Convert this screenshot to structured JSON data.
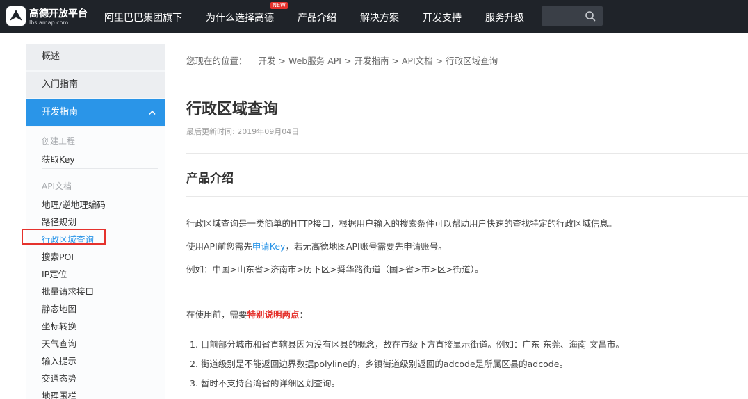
{
  "header": {
    "logo_title": "高德开放平台",
    "logo_sub": "lbs.amap.com",
    "nav": [
      {
        "label": "阿里巴巴集团旗下"
      },
      {
        "label": "为什么选择高德",
        "badge": "NEW"
      },
      {
        "label": "产品介绍"
      },
      {
        "label": "解决方案"
      },
      {
        "label": "开发支持"
      },
      {
        "label": "服务升级"
      }
    ],
    "search_placeholder": ""
  },
  "sidebar": {
    "sections": [
      "概述",
      "入门指南",
      "开发指南"
    ],
    "group1_label": "创建工程",
    "group1_links": [
      "获取Key"
    ],
    "group2_label": "API文档",
    "group2_links": [
      "地理/逆地理编码",
      "路径规划",
      "行政区域查询",
      "搜索POI",
      "IP定位",
      "批量请求接口",
      "静态地图",
      "坐标转换",
      "天气查询",
      "输入提示",
      "交通态势",
      "地理围栏"
    ],
    "current": "行政区域查询"
  },
  "breadcrumb": {
    "label": "您现在的位置：",
    "items": [
      "开发",
      "Web服务 API",
      "开发指南",
      "API文档",
      "行政区域查询"
    ],
    "sep": ">"
  },
  "page": {
    "title": "行政区域查询",
    "updated": "最后更新时间: 2019年09月04日",
    "section_title": "产品介绍",
    "p1": "行政区域查询是一类简单的HTTP接口，根据用户输入的搜索条件可以帮助用户快速的查找特定的行政区域信息。",
    "p2_before": "使用API前您需先",
    "p2_link": "申请Key",
    "p2_after": "，若无高德地图API账号需要先申请账号。",
    "p3": "例如：中国>山东省>济南市>历下区>舜华路街道（国>省>市>区>街道）。",
    "p4_before": "在使用前，需要",
    "p4_emph": "特别说明两点",
    "p4_after": "：",
    "notes": [
      "1. 目前部分城市和省直辖县因为没有区县的概念，故在市级下方直接显示街道。例如：广东-东莞、海南-文昌市。",
      "2. 街道级别是不能返回边界数据polyline的，乡镇街道级别返回的adcode是所属区县的adcode。",
      "3. 暂时不支持台湾省的详细区划查询。"
    ]
  },
  "colors": {
    "accent": "#2a95e8",
    "header_bg": "#1f2329",
    "highlight": "#e5322d"
  }
}
